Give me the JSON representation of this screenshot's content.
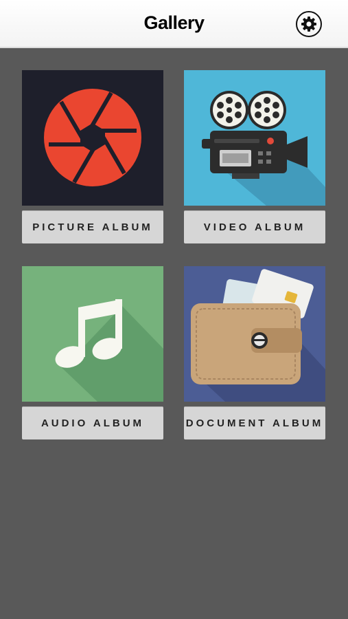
{
  "header": {
    "title": "Gallery",
    "settings_icon": "gear-icon"
  },
  "albums": [
    {
      "label": "PICTURE ALBUM",
      "icon": "camera-aperture-icon",
      "color": "#1f1f2b"
    },
    {
      "label": "VIDEO ALBUM",
      "icon": "film-camera-icon",
      "color": "#4fb7d8"
    },
    {
      "label": "AUDIO ALBUM",
      "icon": "music-note-icon",
      "color": "#74b27b"
    },
    {
      "label": "DOCUMENT ALBUM",
      "icon": "wallet-icon",
      "color": "#4d5e96"
    }
  ]
}
